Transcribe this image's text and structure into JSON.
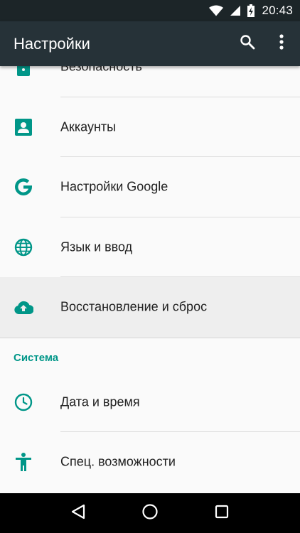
{
  "status_bar": {
    "time": "20:43",
    "icons": [
      "wifi-icon",
      "cell-signal-icon",
      "battery-charging-icon"
    ]
  },
  "app_bar": {
    "title": "Настройки",
    "actions": [
      "search-icon",
      "more-vert-icon"
    ]
  },
  "settings": {
    "items": [
      {
        "label": "Безопасность",
        "icon": "lock-icon"
      },
      {
        "label": "Аккаунты",
        "icon": "account-icon"
      },
      {
        "label": "Настройки Google",
        "icon": "google-icon"
      },
      {
        "label": "Язык и ввод",
        "icon": "globe-icon"
      },
      {
        "label": "Восстановление и сброс",
        "icon": "cloud-upload-icon",
        "pressed": true
      }
    ],
    "section_header": "Система",
    "system_items": [
      {
        "label": "Дата и время",
        "icon": "clock-icon"
      },
      {
        "label": "Спец. возможности",
        "icon": "accessibility-icon"
      }
    ]
  },
  "nav_bar": {
    "buttons": [
      "back-icon",
      "home-icon",
      "recents-icon"
    ]
  },
  "colors": {
    "accent": "#009688",
    "app_bar": "#263238",
    "status_bar": "#1c2528",
    "pressed_bg": "#eeeeee"
  }
}
